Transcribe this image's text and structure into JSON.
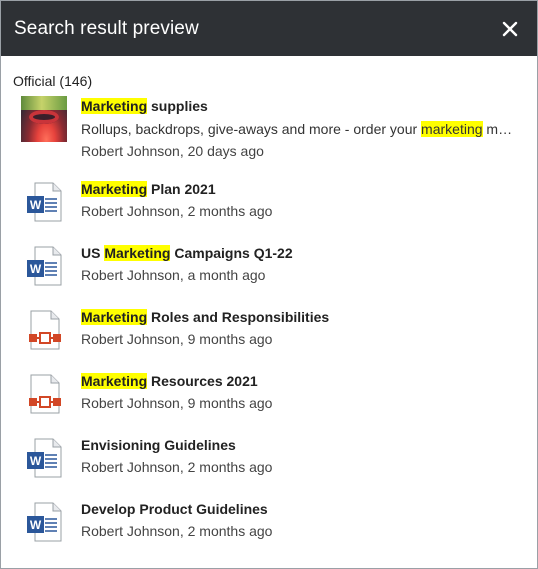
{
  "header": {
    "title": "Search result preview",
    "close_icon": "close-icon"
  },
  "section": {
    "title": "Official (146)"
  },
  "highlight_color": "#ffff00",
  "results": [
    {
      "icon": "image-thumbnail",
      "title_parts": [
        {
          "text": "Marketing",
          "hl": true
        },
        {
          "text": " supplies",
          "hl": false
        }
      ],
      "desc_parts": [
        {
          "text": "Rollups, backdrops, give-aways and more - order your ",
          "hl": false
        },
        {
          "text": "marketing",
          "hl": true
        },
        {
          "text": " m…",
          "hl": false
        }
      ],
      "meta": "Robert Johnson, 20 days ago"
    },
    {
      "icon": "word-doc-icon",
      "title_parts": [
        {
          "text": "Marketing",
          "hl": true
        },
        {
          "text": " Plan 2021",
          "hl": false
        }
      ],
      "meta": "Robert Johnson, 2 months ago"
    },
    {
      "icon": "word-doc-icon",
      "title_parts": [
        {
          "text": "US ",
          "hl": false
        },
        {
          "text": "Marketing",
          "hl": true
        },
        {
          "text": " Campaigns Q1-22",
          "hl": false
        }
      ],
      "meta": "Robert Johnson, a month ago"
    },
    {
      "icon": "powerpoint-doc-icon",
      "title_parts": [
        {
          "text": "Marketing",
          "hl": true
        },
        {
          "text": " Roles and Responsibilities",
          "hl": false
        }
      ],
      "meta": "Robert Johnson, 9 months ago"
    },
    {
      "icon": "powerpoint-doc-icon",
      "title_parts": [
        {
          "text": "Marketing",
          "hl": true
        },
        {
          "text": " Resources 2021",
          "hl": false
        }
      ],
      "meta": "Robert Johnson, 9 months ago"
    },
    {
      "icon": "word-doc-icon",
      "title_parts": [
        {
          "text": "Envisioning Guidelines",
          "hl": false
        }
      ],
      "meta": "Robert Johnson, 2 months ago"
    },
    {
      "icon": "word-doc-icon",
      "title_parts": [
        {
          "text": "Develop Product Guidelines",
          "hl": false
        }
      ],
      "meta": "Robert Johnson, 2 months ago"
    }
  ]
}
